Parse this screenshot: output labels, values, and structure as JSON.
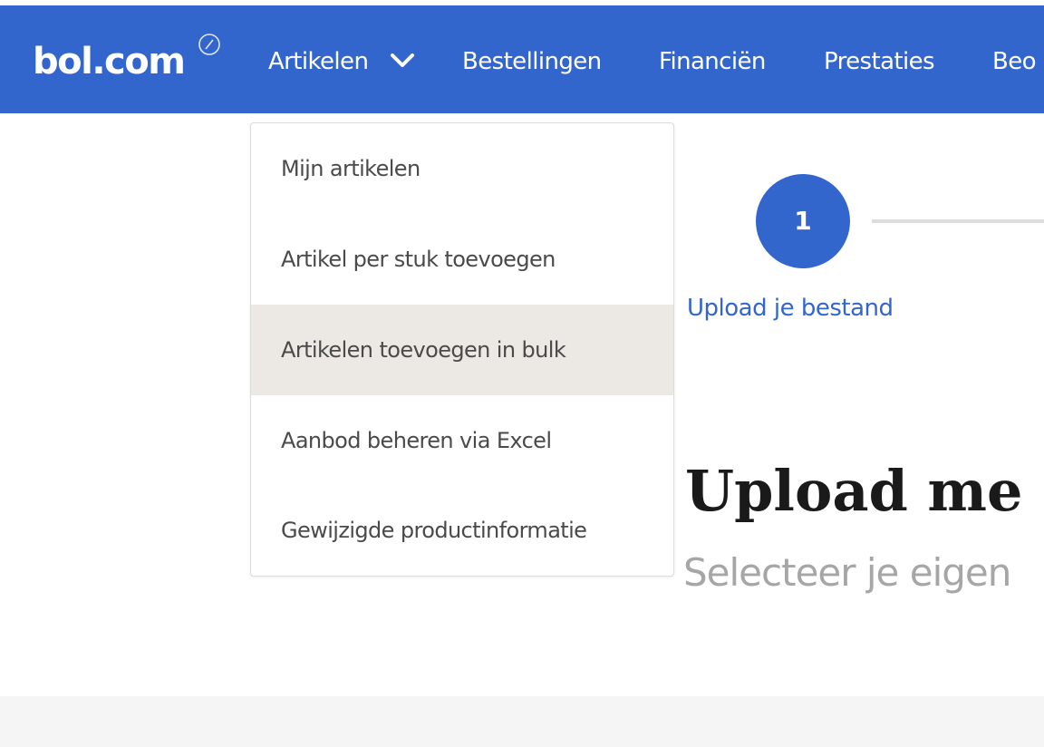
{
  "header": {
    "logo_text": "bol.com",
    "nav": [
      {
        "label": "Artikelen"
      },
      {
        "label": "Bestellingen"
      },
      {
        "label": "Financiën"
      },
      {
        "label": "Prestaties"
      },
      {
        "label": "Beo"
      }
    ]
  },
  "dropdown": {
    "items": [
      {
        "label": "Mijn artikelen"
      },
      {
        "label": "Artikel per stuk toevoegen"
      },
      {
        "label": "Artikelen toevoegen in bulk",
        "active": true
      },
      {
        "label": "Aanbod beheren via Excel"
      },
      {
        "label": "Gewijzigde productinformatie"
      }
    ]
  },
  "stepper": {
    "step_number": "1",
    "step_label": "Upload je bestand"
  },
  "main": {
    "heading": "Upload me",
    "subheading": "Selecteer je eigen"
  },
  "colors": {
    "brand_blue": "#3366cc",
    "menu_active_bg": "#ece9e4"
  }
}
